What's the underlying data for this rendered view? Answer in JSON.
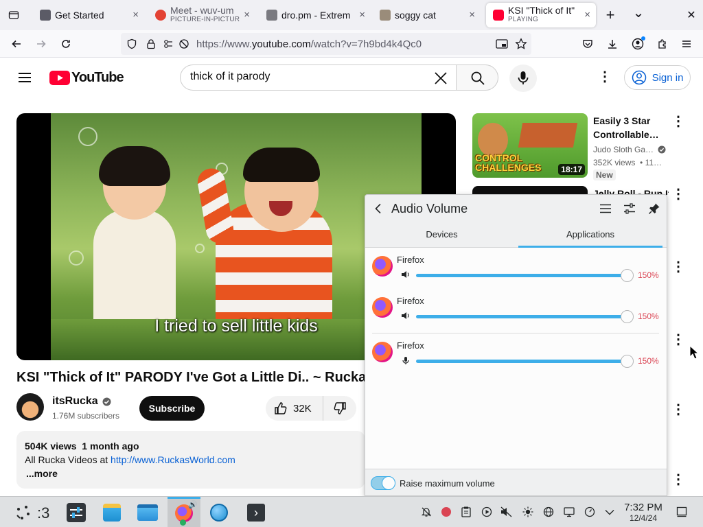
{
  "browser": {
    "tabs": [
      {
        "title": "Get Started",
        "subtitle": "",
        "favicon_color": "#5b5b66",
        "active": false
      },
      {
        "title": "Meet - wuv-um",
        "subtitle": "PICTURE-IN-PICTUR",
        "favicon_color": "#e34234",
        "active": false
      },
      {
        "title": "dro.pm - Extrem",
        "subtitle": "",
        "favicon_color": "#7a7a80",
        "active": false
      },
      {
        "title": "soggy cat",
        "subtitle": "",
        "favicon_color": "#9a8c7a",
        "active": false
      },
      {
        "title": "KSI \"Thick of It\"",
        "subtitle": "PLAYING",
        "favicon_color": "#ff0033",
        "active": true
      }
    ],
    "tab_close_glyph": "×",
    "new_tab_glyph": "+",
    "list_tabs_glyph": "⌄",
    "window_close_glyph": "✕",
    "url_prefix": "https://www.",
    "url_host": "youtube.com",
    "url_path": "/watch?v=7h9bd4k4Qc0"
  },
  "youtube": {
    "logo_text": "YouTube",
    "search_value": "thick of it parody",
    "signin_label": "Sign in",
    "subtitle_caption": "I tried to sell little kids",
    "video_title": "KSI \"Thick of It\" PARODY I've Got a Little Di.. ~ Rucka Ruc",
    "channel_name": "itsRucka",
    "subscribers": "1.76M subscribers",
    "subscribe_label": "Subscribe",
    "likes": "32K",
    "views": "504K views",
    "age": "1 month ago",
    "desc_prefix": "All Rucka Videos at ",
    "desc_link": "http://www.RuckasWorld.com",
    "more_label": "...more",
    "recommended": [
      {
        "title_line1": "Easily 3 Star",
        "title_line2": "Controllable…",
        "channel": "Judo Sloth Ga…",
        "meta": "352K views  • 11…",
        "badge": "New",
        "duration": "18:17",
        "thumb_text": "CONTROL CHALLENGES"
      },
      {
        "title_line1": "Jelly Roll - Run It"
      }
    ]
  },
  "audio_panel": {
    "title": "Audio Volume",
    "tabs": [
      "Devices",
      "Applications"
    ],
    "active_tab": "Applications",
    "streams": [
      {
        "name": "Firefox",
        "volume_percent": 150,
        "volume_label": "150%",
        "icon": "speaker-icon"
      },
      {
        "name": "Firefox",
        "volume_percent": 150,
        "volume_label": "150%",
        "icon": "speaker-icon"
      },
      {
        "name": "Firefox",
        "volume_percent": 150,
        "volume_label": "150%",
        "icon": "microphone-icon"
      }
    ],
    "raise_max_label": "Raise maximum volume",
    "raise_max_enabled": true
  },
  "taskbar": {
    "virtual_desktop_label": ":3",
    "clock_time": "7:32 PM",
    "clock_date": "12/4/24"
  },
  "colors": {
    "accent_blue": "#3daee9",
    "volume_red": "#da4453",
    "youtube_red": "#ff0033",
    "link_blue": "#065fd4"
  }
}
